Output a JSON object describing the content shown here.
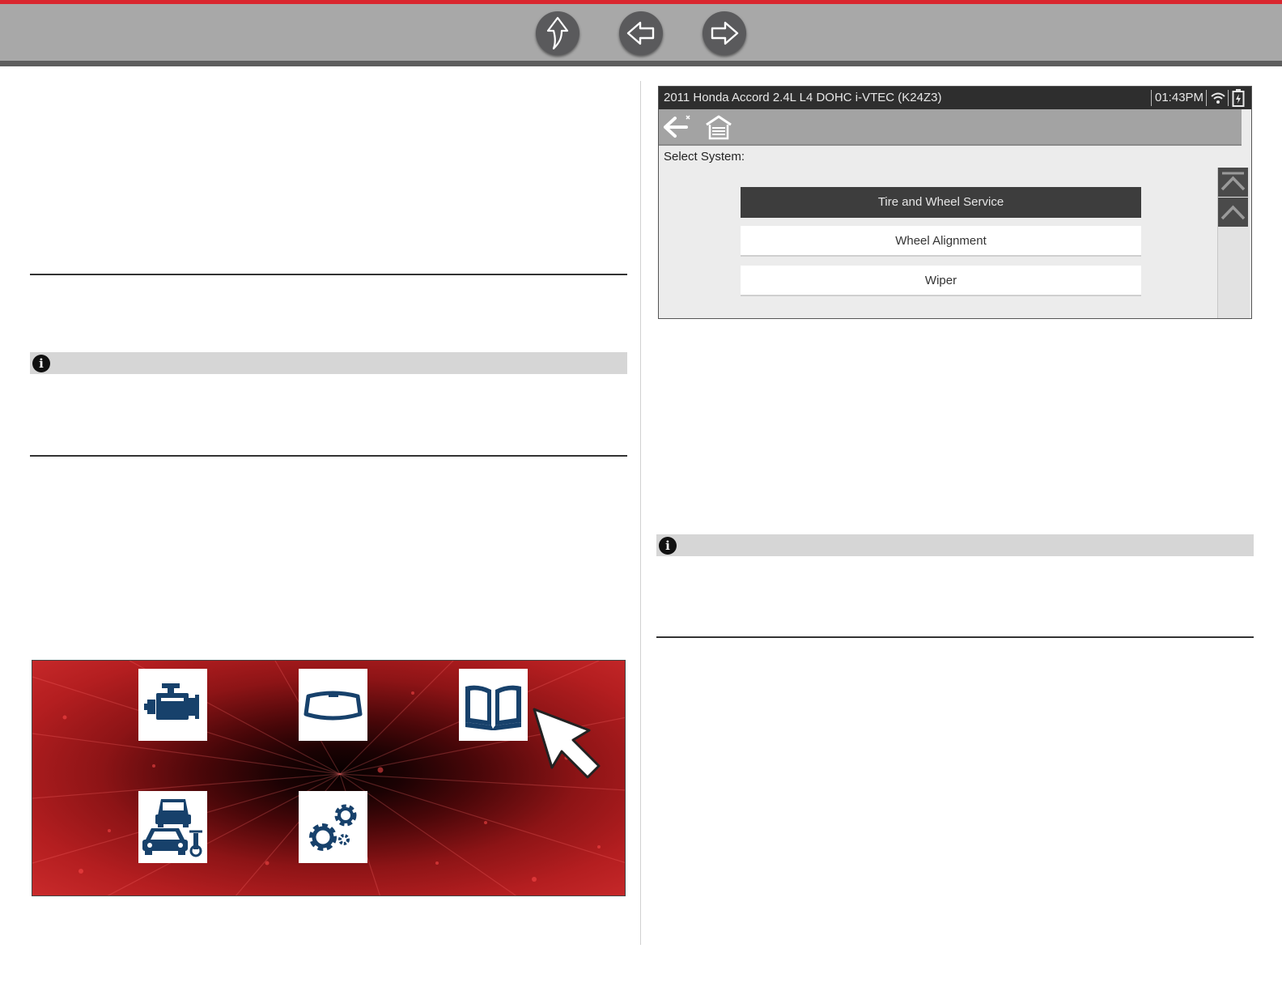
{
  "nav": {
    "up_icon": "up-arrow-icon",
    "back_icon": "back-arrow-icon",
    "forward_icon": "forward-arrow-icon"
  },
  "colors": {
    "accent_red": "#d9262e",
    "toolbar_gray": "#a8a8a8",
    "tile_icon_blue": "#17416b",
    "selected_button": "#3d3d3d"
  },
  "scanner": {
    "status_bar": {
      "vehicle": "2011 Honda Accord 2.4L L4 DOHC i-VTEC (K24Z3)",
      "time": "01:43PM",
      "wifi_icon": "wifi-icon",
      "battery_icon": "battery-icon"
    },
    "toolbar": {
      "back_icon": "back-arrow-icon",
      "home_icon": "garage-home-icon"
    },
    "prompt": "Select System:",
    "systems": [
      {
        "label": "Tire and Wheel Service",
        "selected": true
      },
      {
        "label": "Wheel Alignment",
        "selected": false
      },
      {
        "label": "Wiper",
        "selected": false
      }
    ],
    "scroll": {
      "top_icon": "scroll-to-top-icon",
      "up_icon": "scroll-up-icon"
    }
  },
  "home_screen": {
    "tiles": [
      {
        "icon": "engine-icon"
      },
      {
        "icon": "windshield-icon"
      },
      {
        "icon": "book-icon"
      },
      {
        "icon": "vehicles-icon"
      },
      {
        "icon": "gears-icon"
      }
    ],
    "cursor_icon": "pointer-cursor-icon"
  }
}
